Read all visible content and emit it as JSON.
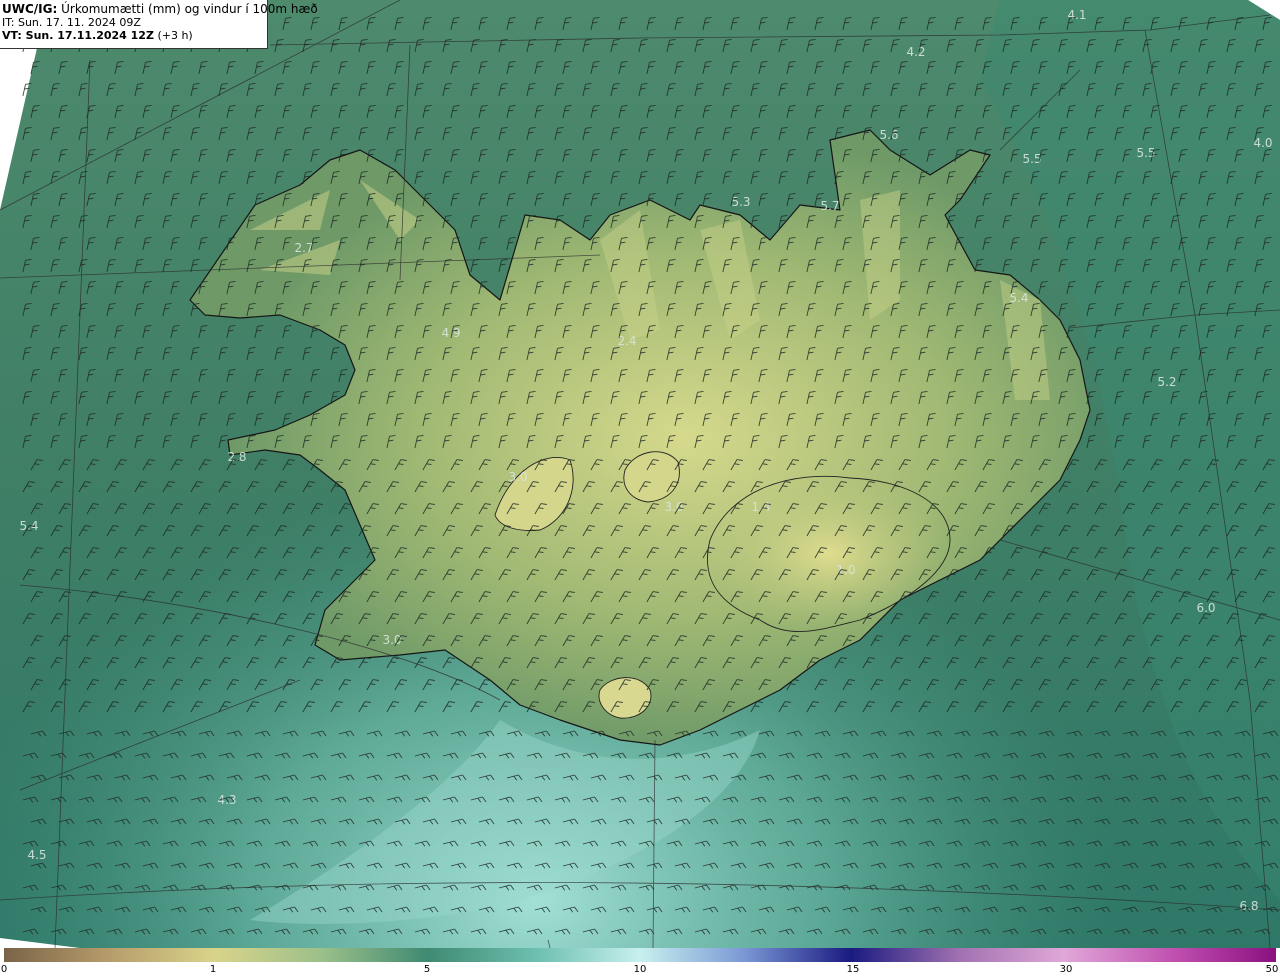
{
  "header": {
    "model": "UWC/IG:",
    "title": "Úrkomumætti (mm) og vindur í 100m hæð",
    "it_label": "IT:",
    "it_value": "Sun. 17. 11. 2024 09Z",
    "vt_label": "VT: Sun. 17.11.2024 12Z",
    "vt_value": "(+3 h)"
  },
  "value_labels": [
    "4.1",
    "4.2",
    "5.6",
    "5.5",
    "5.5",
    "4.0",
    "5.3",
    "5.7",
    "2.7",
    "5.4",
    "4.9",
    "2.4",
    "5.2",
    "2.8",
    "3.0",
    "3.6",
    "1.4",
    "5.4",
    "1.0",
    "6.0",
    "3.0",
    "4.3",
    "4.5",
    "6.8"
  ],
  "colorbar": {
    "ticks": [
      "0",
      "1",
      "5",
      "10",
      "15",
      "30",
      "50"
    ],
    "tick_values": [
      0,
      1,
      5,
      10,
      15,
      30,
      50
    ]
  },
  "colors": {
    "sea_dark": "#2f7d6a",
    "sea_light": "#5fb8a8",
    "land": "#8fae6a",
    "land_light": "#c9d488",
    "coast": "#1a1a1a"
  }
}
